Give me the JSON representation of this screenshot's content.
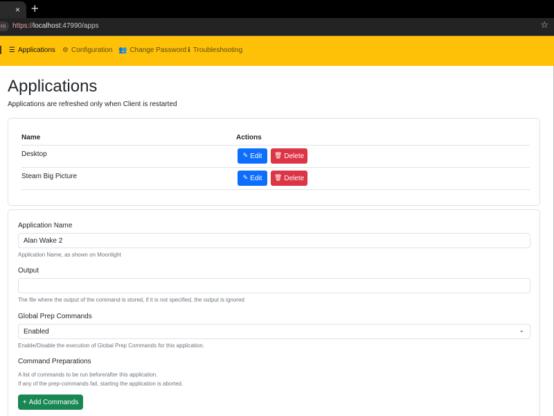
{
  "browser": {
    "tab_close": "×",
    "new_tab": "+",
    "profile_badge": "ro",
    "url_scheme": "https://",
    "url_host": "localhost",
    "url_rest": ":47990/apps",
    "star": "☆"
  },
  "nav": {
    "items": [
      {
        "label": "Applications",
        "icon": "list-icon",
        "glyph": "☰"
      },
      {
        "label": "Configuration",
        "icon": "gear-icon",
        "glyph": "⚙"
      },
      {
        "label": "Change Password",
        "icon": "user-lock-icon",
        "glyph": "👥"
      },
      {
        "label": "Troubleshooting",
        "icon": "info-icon",
        "glyph": "ℹ"
      }
    ]
  },
  "page": {
    "title": "Applications",
    "subtitle": "Applications are refreshed only when Client is restarted"
  },
  "apps_table": {
    "headers": {
      "name": "Name",
      "actions": "Actions"
    },
    "rows": [
      {
        "name": "Desktop",
        "edit": "Edit",
        "delete": "Delete"
      },
      {
        "name": "Steam Big Picture",
        "edit": "Edit",
        "delete": "Delete"
      }
    ],
    "edit_glyph": "✎",
    "delete_glyph": "🗑"
  },
  "form": {
    "app_name_label": "Application Name",
    "app_name_value": "Alan Wake 2",
    "app_name_help": "Application Name, as shown on Moonlight",
    "output_label": "Output",
    "output_value": "",
    "output_help": "The file where the output of the command is stored, if it is not specified, the output is ignored",
    "global_prep_label": "Global Prep Commands",
    "global_prep_value": "Enabled",
    "global_prep_help": "Enable/Disable the execution of Global Prep Commands for this application.",
    "cmd_prep_label": "Command Preparations",
    "cmd_prep_help_1": "A list of commands to be run before/after this application.",
    "cmd_prep_help_2": "If any of the prep-commands fail, starting the application is aborted.",
    "add_commands_label": "Add Commands",
    "add_glyph": "+"
  },
  "colors": {
    "navbar": "#ffc107",
    "primary": "#0d6efd",
    "danger": "#dc3545",
    "success": "#198754"
  }
}
